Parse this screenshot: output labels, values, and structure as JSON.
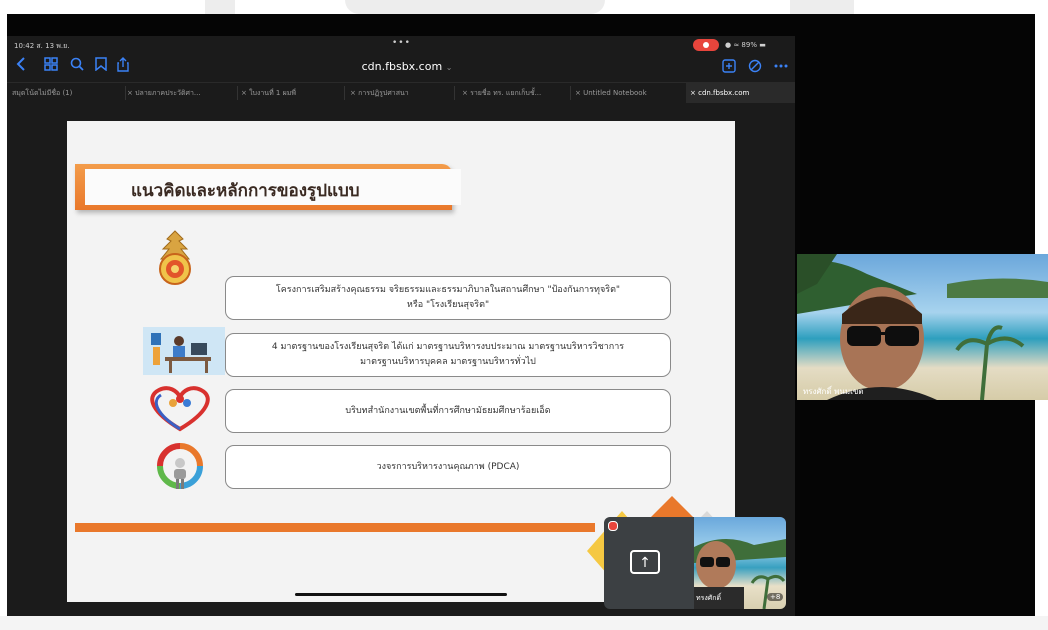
{
  "status_bar": {
    "time": "10:42 ส. 13 พ.ย.",
    "dots": "•••",
    "battery": "● ≈ 89% ▬"
  },
  "toolbar": {
    "url": "cdn.fbsbx.com",
    "url_chevron": "⌄",
    "left_icons": [
      "back-icon",
      "grid-icon",
      "search-icon",
      "bookmark-icon",
      "share-icon"
    ],
    "right_icons": [
      "new-tab-icon",
      "tracker-icon",
      "more-icon"
    ]
  },
  "tabs": [
    {
      "label": "สมุดโน้ตไม่มีชื่อ (1)"
    },
    {
      "label": "× ปลายภาคประวัติศา..."
    },
    {
      "label": "× ใบงานที่ 1 ผมพี่"
    },
    {
      "label": "× การปฏิรูปศาสนา"
    },
    {
      "label": "× รายชื่อ ทร. แยกเก็บชั้..."
    },
    {
      "label": "× Untitled Notebook"
    },
    {
      "label": "× cdn.fbsbx.com"
    }
  ],
  "slide": {
    "title": "แนวคิดและหลักการของรูปแบบ",
    "rows": [
      {
        "line1": "โครงการเสริมสร้างคุณธรรม จริยธรรมและธรรมาภิบาลในสถานศึกษา \"ป้องกันการทุจริต\"",
        "line2": "หรือ \"โรงเรียนสุจริต\""
      },
      {
        "line1": "4 มาตรฐานของโรงเรียนสุจริต ได้แก่ มาตรฐานบริหารงบประมาณ มาตรฐานบริหารวิชาการ",
        "line2": "มาตรฐานบริหารบุคคล มาตรฐานบริหารทั่วไป"
      },
      {
        "line1": "บริบทสำนักงานเขตพื้นที่การศึกษามัธยมศึกษาร้อยเอ็ด",
        "line2": ""
      },
      {
        "line1": "วงจรการบริหารงานคุณภาพ (PDCA)",
        "line2": ""
      }
    ]
  },
  "pip": {
    "share_icon": "↑",
    "name": "ทรงศักดิ์",
    "more": "+8"
  },
  "side_video": {
    "name": "ทรงศักดิ์ พนมเขต"
  },
  "colors": {
    "accent": "#e9782b",
    "title_text": "#3a2a22",
    "link_blue": "#3b82f6",
    "rec_red": "#e8453c"
  }
}
